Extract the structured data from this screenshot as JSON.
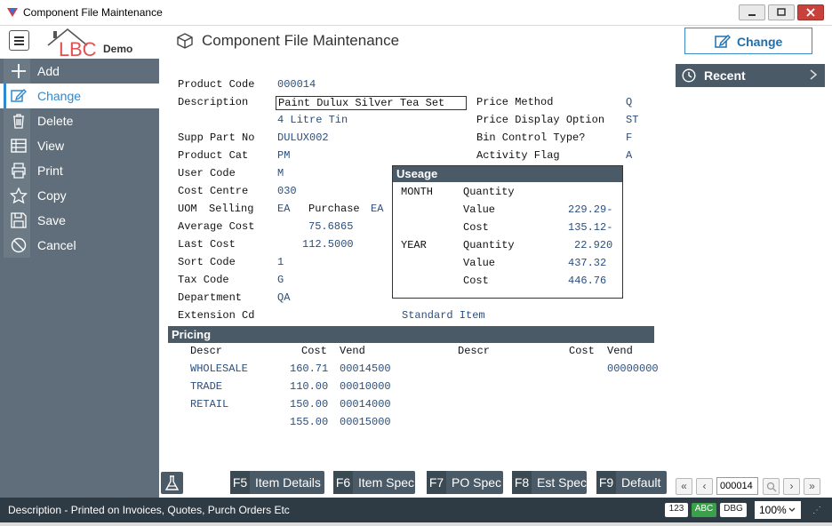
{
  "window": {
    "title": "Component File Maintenance"
  },
  "header": {
    "logo_letters": "BC",
    "logo_suffix": "Demo",
    "page_title": "Component File Maintenance",
    "action_button": "Change"
  },
  "sidebar": {
    "items": [
      {
        "label": "Add",
        "icon": "plus-icon",
        "active": false
      },
      {
        "label": "Change",
        "icon": "edit-icon",
        "active": true
      },
      {
        "label": "Delete",
        "icon": "trash-icon",
        "active": false
      },
      {
        "label": "View",
        "icon": "table-icon",
        "active": false
      },
      {
        "label": "Print",
        "icon": "printer-icon",
        "active": false
      },
      {
        "label": "Copy",
        "icon": "star-icon",
        "active": false
      },
      {
        "label": "Save",
        "icon": "save-icon",
        "active": false
      },
      {
        "label": "Cancel",
        "icon": "cancel-icon",
        "active": false
      }
    ]
  },
  "recent": {
    "label": "Recent"
  },
  "form": {
    "product_code_label": "Product Code",
    "product_code": "000014",
    "description_label": "Description",
    "description": "Paint Dulux Silver Tea Set",
    "description2": "4 Litre Tin",
    "supp_part_label": "Supp Part No",
    "supp_part": "DULUX002",
    "product_cat_label": "Product Cat",
    "product_cat": "PM",
    "user_code_label": "User Code",
    "user_code": "M",
    "cost_centre_label": "Cost Centre",
    "cost_centre": "030",
    "uom_label": "UOM",
    "uom_selling_label": "Selling",
    "uom_selling": "EA",
    "uom_purchase_label": "Purchase",
    "uom_purchase": "EA",
    "avg_cost_label": "Average Cost",
    "avg_cost": "75.6865",
    "last_cost_label": "Last Cost",
    "last_cost": "112.5000",
    "sort_code_label": "Sort Code",
    "sort_code": "1",
    "tax_code_label": "Tax Code",
    "tax_code": "G",
    "department_label": "Department",
    "department": "QA",
    "extension_label": "Extension Cd",
    "extension_text": "Standard Item",
    "price_method_label": "Price Method",
    "price_method": "Q",
    "price_display_label": "Price Display Option",
    "price_display": "ST",
    "bin_control_label": "Bin Control Type?",
    "bin_control": "F",
    "activity_flag_label": "Activity Flag",
    "activity_flag": "A"
  },
  "useage": {
    "title": "Useage",
    "month_label": "MONTH",
    "year_label": "YEAR",
    "quantity_label": "Quantity",
    "value_label": "Value",
    "cost_label": "Cost",
    "month_value": "229.29-",
    "month_cost": "135.12-",
    "year_quantity": "22.920",
    "year_value": "437.32",
    "year_cost": "446.76"
  },
  "pricing": {
    "title": "Pricing",
    "headers": {
      "descr": "Descr",
      "cost": "Cost",
      "vend": "Vend"
    },
    "left_rows": [
      {
        "descr": "WHOLESALE",
        "cost": "160.71",
        "vend": "00014500"
      },
      {
        "descr": "TRADE",
        "cost": "110.00",
        "vend": "00010000"
      },
      {
        "descr": "RETAIL",
        "cost": "150.00",
        "vend": "00014000"
      },
      {
        "descr": "",
        "cost": "155.00",
        "vend": "00015000"
      }
    ],
    "right_rows": [
      {
        "descr": "",
        "cost": "",
        "vend": "00000000"
      }
    ]
  },
  "fkeys": [
    {
      "key": "F5",
      "label": "Item Details"
    },
    {
      "key": "F6",
      "label": "Item Spec"
    },
    {
      "key": "F7",
      "label": "PO Spec"
    },
    {
      "key": "F8",
      "label": "Est Spec"
    },
    {
      "key": "F9",
      "label": "Default"
    }
  ],
  "navigator": {
    "record": "000014"
  },
  "status": {
    "message": "Description - Printed on Invoices, Quotes, Purch Orders Etc",
    "badge_num": "123",
    "badge_abc": "ABC",
    "badge_dbg": "DBG",
    "zoom": "100%",
    "colors": {
      "abc": "#3aa04a",
      "accent": "#2d8ad2",
      "dark": "#4a5a67"
    }
  }
}
